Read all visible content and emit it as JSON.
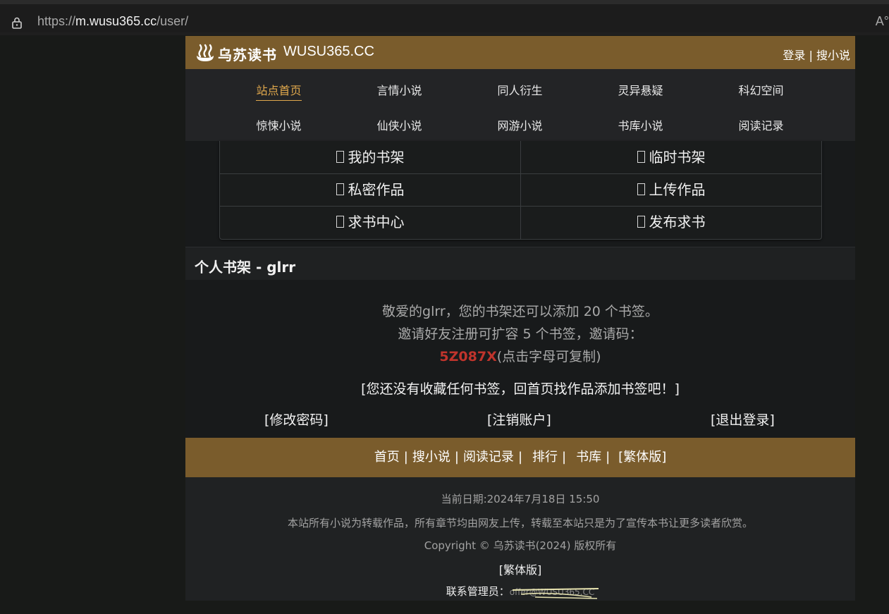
{
  "browser": {
    "url_prefix": "https://",
    "url_host": "m.wusu365.cc",
    "url_path": "/user/",
    "reader_icon": "A°"
  },
  "header": {
    "logo_cn": "乌苏读书",
    "logo_en": "WUSU365.CC",
    "login": "登录",
    "separator": "|",
    "search": "搜小说"
  },
  "nav": {
    "items": [
      {
        "label": "站点首页",
        "active": true
      },
      {
        "label": "言情小说"
      },
      {
        "label": "同人衍生"
      },
      {
        "label": "灵异悬疑"
      },
      {
        "label": "科幻空间"
      },
      {
        "label": "惊悚小说"
      },
      {
        "label": "仙侠小说"
      },
      {
        "label": "网游小说"
      },
      {
        "label": "书库小说"
      },
      {
        "label": "阅读记录"
      }
    ]
  },
  "user_menu": {
    "items": [
      {
        "label": "我的书架"
      },
      {
        "label": "临时书架"
      },
      {
        "label": "私密作品"
      },
      {
        "label": "上传作品"
      },
      {
        "label": "求书中心"
      },
      {
        "label": "发布求书"
      }
    ]
  },
  "shelf": {
    "title": "个人书架 - glrr",
    "line1": "敬爱的glrr，您的书架还可以添加 20 个书签。",
    "line2": "邀请好友注册可扩容 5 个书签，邀请码：",
    "invite_code": "5Z087X",
    "invite_hint": "(点击字母可复制)",
    "empty_note": "[您还没有收藏任何书签，回首页找作品添加书签吧！]",
    "change_password": "[修改密码]",
    "cancel_account": "[注销账户]",
    "logout": "[退出登录]"
  },
  "footer_nav": {
    "home": "首页",
    "search": "搜小说",
    "history": "阅读记录",
    "rank": "排行",
    "library": "书库",
    "traditional": "[繁体版]",
    "sep": "|"
  },
  "footer": {
    "date": "当前日期:2024年7月18日 15:50",
    "disclaimer": "本站所有小说为转载作品，所有章节均由网友上传，转载至本站只是为了宣传本书让更多读者欣赏。",
    "copyright": "Copyright © 乌苏读书(2024) 版权所有",
    "traditional": "[繁体版]",
    "contact_label": "联系管理员：",
    "contact_email": "offer@WUSU365.CC"
  }
}
